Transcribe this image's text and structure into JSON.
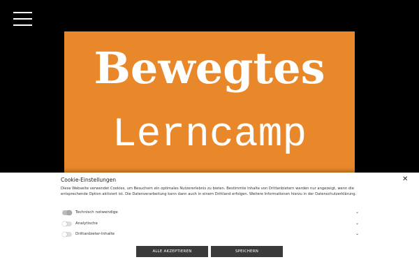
{
  "header": {
    "menu_icon": "hamburger-menu-icon"
  },
  "logo": {
    "line1": "Bewegtes",
    "line2": "Lerncamp",
    "background_color": "#e8882a"
  },
  "cookie": {
    "title": "Cookie-Einstellungen",
    "close_icon": "close-icon",
    "close_label": "✕",
    "description": "Diese Webseite verwendet Cookies, um Besuchern ein optimales Nutzererlebnis zu bieten. Bestimmte Inhalte von Drittanbietern werden nur angezeigt, wenn die entsprechende Option aktiviert ist. Die Datenverarbeitung kann dann auch in einem Drittland erfolgen. Weitere Informationen hierzu in der Datenschutzerklärung.",
    "options": [
      {
        "label": "Technisch notwendige",
        "enabled": true
      },
      {
        "label": "Analytische",
        "enabled": false
      },
      {
        "label": "Drittanbieter-Inhalte",
        "enabled": false
      }
    ],
    "chevron": "⌄",
    "accept_all_label": "ALLE AKZEPTIEREN",
    "save_label": "SPEICHERN"
  }
}
